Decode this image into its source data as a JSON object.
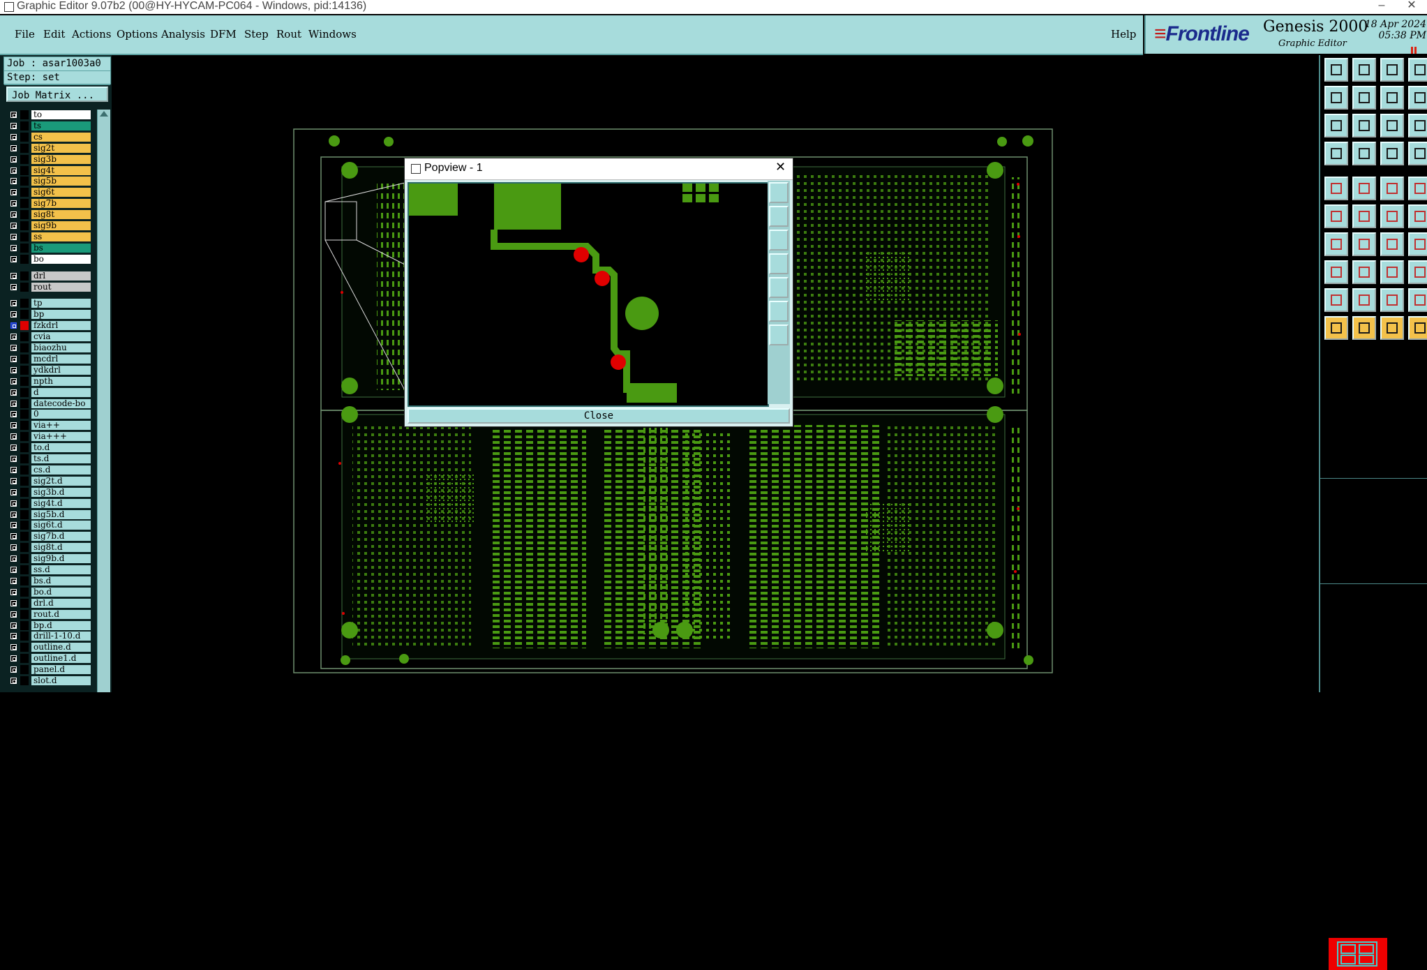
{
  "window": {
    "title": "Graphic Editor 9.07b2 (00@HY-HYCAM-PC064 - Windows, pid:14136)",
    "controls": [
      "–",
      "☐",
      "✕"
    ]
  },
  "menubar": {
    "items": [
      "File",
      "Edit",
      "Actions",
      "Options",
      "Analysis",
      "DFM",
      "Step",
      "Rout",
      "Windows"
    ],
    "help": "Help"
  },
  "brand": {
    "logo": "Frontline",
    "product": "Genesis 2000",
    "subtitle": "Graphic Editor",
    "date": "18 Apr 2024",
    "time": "05:38 PM"
  },
  "job": {
    "job_label": "Job : asar1003a0",
    "step_label": "Step: set",
    "matrix_button": "Job Matrix ..."
  },
  "layers": [
    {
      "name": "to",
      "bg": "#ffffff",
      "swatch": "#000000"
    },
    {
      "name": "ts",
      "bg": "#1a9a7a",
      "swatch": "#000000"
    },
    {
      "name": "cs",
      "bg": "#f3c14a",
      "swatch": "#000000"
    },
    {
      "name": "sig2t",
      "bg": "#f3c14a",
      "swatch": "#000000"
    },
    {
      "name": "sig3b",
      "bg": "#f3c14a",
      "swatch": "#000000"
    },
    {
      "name": "sig4t",
      "bg": "#f3c14a",
      "swatch": "#000000"
    },
    {
      "name": "sig5b",
      "bg": "#f3c14a",
      "swatch": "#000000"
    },
    {
      "name": "sig6t",
      "bg": "#f3c14a",
      "swatch": "#000000"
    },
    {
      "name": "sig7b",
      "bg": "#f3c14a",
      "swatch": "#000000"
    },
    {
      "name": "sig8t",
      "bg": "#f3c14a",
      "swatch": "#000000"
    },
    {
      "name": "sig9b",
      "bg": "#f3c14a",
      "swatch": "#000000"
    },
    {
      "name": "ss",
      "bg": "#f3c14a",
      "swatch": "#000000"
    },
    {
      "name": "bs",
      "bg": "#1a9a7a",
      "swatch": "#000000"
    },
    {
      "name": "bo",
      "bg": "#ffffff",
      "swatch": "#000000"
    },
    {
      "name": "drl",
      "bg": "#c8c8c8",
      "swatch": "#000000",
      "gap": true
    },
    {
      "name": "rout",
      "bg": "#c8c8c8",
      "swatch": "#000000"
    },
    {
      "name": "tp",
      "bg": "#a7dcdc",
      "swatch": "#000000",
      "gap": true
    },
    {
      "name": "bp",
      "bg": "#a7dcdc",
      "swatch": "#000000"
    },
    {
      "name": "fzkdrl",
      "bg": "#a7dcdc",
      "swatch": "#e00000",
      "active": true
    },
    {
      "name": "cvia",
      "bg": "#a7dcdc",
      "swatch": "#000000"
    },
    {
      "name": "biaozhu",
      "bg": "#a7dcdc",
      "swatch": "#000000"
    },
    {
      "name": "mcdrl",
      "bg": "#a7dcdc",
      "swatch": "#000000"
    },
    {
      "name": "ydkdrl",
      "bg": "#a7dcdc",
      "swatch": "#000000"
    },
    {
      "name": "npth",
      "bg": "#a7dcdc",
      "swatch": "#000000"
    },
    {
      "name": "d",
      "bg": "#a7dcdc",
      "swatch": "#000000"
    },
    {
      "name": "datecode-bo",
      "bg": "#a7dcdc",
      "swatch": "#000000"
    },
    {
      "name": "0",
      "bg": "#a7dcdc",
      "swatch": "#000000"
    },
    {
      "name": "via++",
      "bg": "#a7dcdc",
      "swatch": "#000000"
    },
    {
      "name": "via+++",
      "bg": "#a7dcdc",
      "swatch": "#000000"
    },
    {
      "name": "to.d",
      "bg": "#a7dcdc",
      "swatch": "#000000"
    },
    {
      "name": "ts.d",
      "bg": "#a7dcdc",
      "swatch": "#000000"
    },
    {
      "name": "cs.d",
      "bg": "#a7dcdc",
      "swatch": "#000000"
    },
    {
      "name": "sig2t.d",
      "bg": "#a7dcdc",
      "swatch": "#000000"
    },
    {
      "name": "sig3b.d",
      "bg": "#a7dcdc",
      "swatch": "#000000"
    },
    {
      "name": "sig4t.d",
      "bg": "#a7dcdc",
      "swatch": "#000000"
    },
    {
      "name": "sig5b.d",
      "bg": "#a7dcdc",
      "swatch": "#000000"
    },
    {
      "name": "sig6t.d",
      "bg": "#a7dcdc",
      "swatch": "#000000"
    },
    {
      "name": "sig7b.d",
      "bg": "#a7dcdc",
      "swatch": "#000000"
    },
    {
      "name": "sig8t.d",
      "bg": "#a7dcdc",
      "swatch": "#000000"
    },
    {
      "name": "sig9b.d",
      "bg": "#a7dcdc",
      "swatch": "#000000"
    },
    {
      "name": "ss.d",
      "bg": "#a7dcdc",
      "swatch": "#000000"
    },
    {
      "name": "bs.d",
      "bg": "#a7dcdc",
      "swatch": "#000000"
    },
    {
      "name": "bo.d",
      "bg": "#a7dcdc",
      "swatch": "#000000"
    },
    {
      "name": "drl.d",
      "bg": "#a7dcdc",
      "swatch": "#000000"
    },
    {
      "name": "rout.d",
      "bg": "#a7dcdc",
      "swatch": "#000000"
    },
    {
      "name": "bp.d",
      "bg": "#a7dcdc",
      "swatch": "#000000"
    },
    {
      "name": "drill-1-10.d",
      "bg": "#a7dcdc",
      "swatch": "#000000"
    },
    {
      "name": "outline.d",
      "bg": "#a7dcdc",
      "swatch": "#000000"
    },
    {
      "name": "outline1.d",
      "bg": "#a7dcdc",
      "swatch": "#000000"
    },
    {
      "name": "panel.d",
      "bg": "#a7dcdc",
      "swatch": "#000000"
    },
    {
      "name": "slot.d",
      "bg": "#a7dcdc",
      "swatch": "#000000"
    }
  ],
  "popview": {
    "title": "Popview - 1",
    "close_label": "Close"
  },
  "colors": {
    "board_green": "#4a9a12",
    "panel_teal": "#a7dcdc",
    "highlight_red": "#e00000",
    "outline_line": "#7a9a7a"
  }
}
